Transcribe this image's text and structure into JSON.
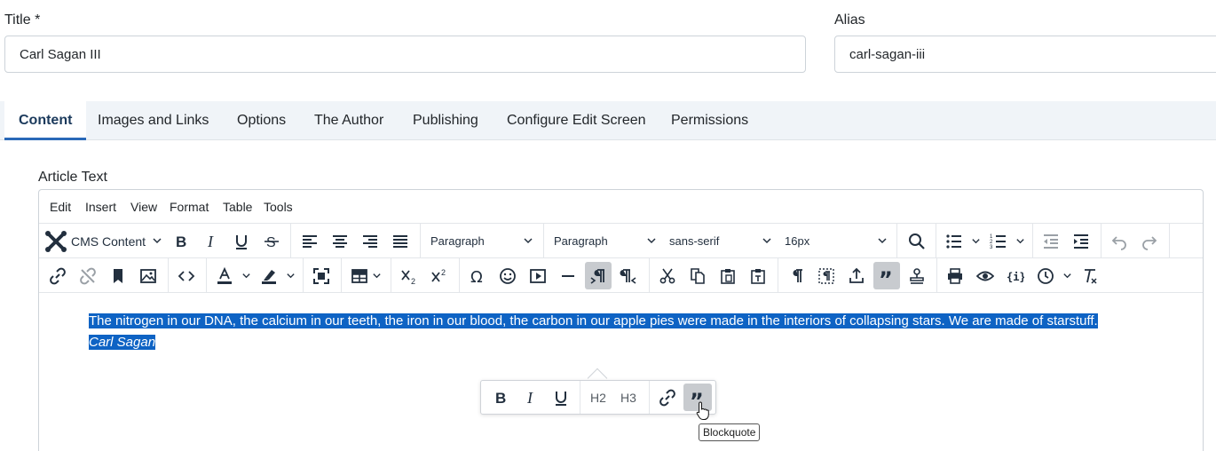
{
  "title_field": {
    "label": "Title *",
    "value": "Carl Sagan III"
  },
  "alias_field": {
    "label": "Alias",
    "value": "carl-sagan-iii"
  },
  "tabs": [
    {
      "label": "Content",
      "active": true
    },
    {
      "label": "Images and Links"
    },
    {
      "label": "Options"
    },
    {
      "label": "The Author"
    },
    {
      "label": "Publishing"
    },
    {
      "label": "Configure Edit Screen"
    },
    {
      "label": "Permissions"
    }
  ],
  "editor": {
    "label": "Article Text",
    "menu": [
      "Edit",
      "Insert",
      "View",
      "Format",
      "Table",
      "Tools"
    ],
    "cms_content": "CMS Content",
    "block_format": "Paragraph",
    "style_format": "Paragraph",
    "font_family": "sans-serif",
    "font_size": "16px",
    "quote_text": "The nitrogen in our DNA, the calcium in our teeth, the iron in our blood, the carbon in our apple pies were made in the interiors of collapsing stars. We are made of starstuff.",
    "quote_author": "Carl Sagan",
    "selection_color": "#0e63c4",
    "quickbar": {
      "h2": "H2",
      "h3": "H3"
    },
    "tooltip": "Blockquote"
  },
  "colors": {
    "accent": "#2a69b8",
    "tab_bg": "#f0f4f8",
    "active_button": "#c8cbcf"
  }
}
